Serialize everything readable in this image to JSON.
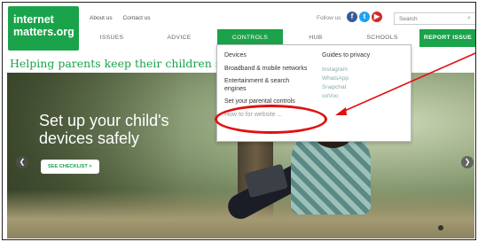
{
  "logo": {
    "line1": "internet",
    "line2": "matters.org"
  },
  "toplinks": [
    "About us",
    "Contact us"
  ],
  "follow_label": "Follow us",
  "social": [
    "f",
    "t",
    "▶"
  ],
  "search": {
    "placeholder": "Search"
  },
  "nav": [
    "ISSUES",
    "ADVICE",
    "CONTROLS",
    "HUB",
    "SCHOOLS",
    "REPORT ISSUE"
  ],
  "tagline": "Helping parents keep their children saf",
  "hero": {
    "title_line1": "Set up your child's",
    "title_line2": "devices safely",
    "checklist_label": "SEE CHECKLIST >"
  },
  "dropdown": {
    "col1": [
      "Devices",
      "Broadband & mobile networks",
      "Entertainment & search engines",
      "Set your parental controls",
      "How to for website ..."
    ],
    "col2_header": "Guides to privacy",
    "col2_items": [
      "Instagram",
      "WhatsApp",
      "Snapchat",
      "ooVoo"
    ]
  },
  "colors": {
    "brand_green": "#1aa34a",
    "annotation_red": "#e01010"
  }
}
